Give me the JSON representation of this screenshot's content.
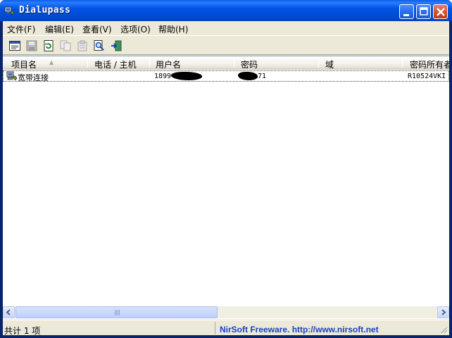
{
  "window": {
    "title": "Dialupass"
  },
  "menu": [
    {
      "label": "文件(F)"
    },
    {
      "label": "编辑(E)"
    },
    {
      "label": "查看(V)"
    },
    {
      "label": "选项(O)"
    },
    {
      "label": "帮助(H)"
    }
  ],
  "toolbar": [
    {
      "icon": "html-report-icon"
    },
    {
      "icon": "save-icon"
    },
    {
      "icon": "refresh-icon"
    },
    {
      "icon": "copy-icon"
    },
    {
      "icon": "properties-icon"
    },
    {
      "icon": "find-icon"
    },
    {
      "icon": "exit-icon"
    }
  ],
  "columns": [
    {
      "label": "项目名"
    },
    {
      "label": "电话 / 主机"
    },
    {
      "label": "用户名"
    },
    {
      "label": "密码"
    },
    {
      "label": "域"
    },
    {
      "label": "密码所有者"
    }
  ],
  "rows": [
    {
      "entry_name": "宽带连接",
      "phone": "",
      "username_visible": "1899",
      "password_visible": "71",
      "domain": "",
      "password_owner": "R10524VKI"
    }
  ],
  "status": {
    "count_text": "共计 1 项",
    "credit_text": "NirSoft Freeware.  http://www.nirsoft.net"
  },
  "colors": {
    "title_blue": "#0054e3",
    "face": "#ece9d8",
    "link": "#1a3ec8"
  }
}
